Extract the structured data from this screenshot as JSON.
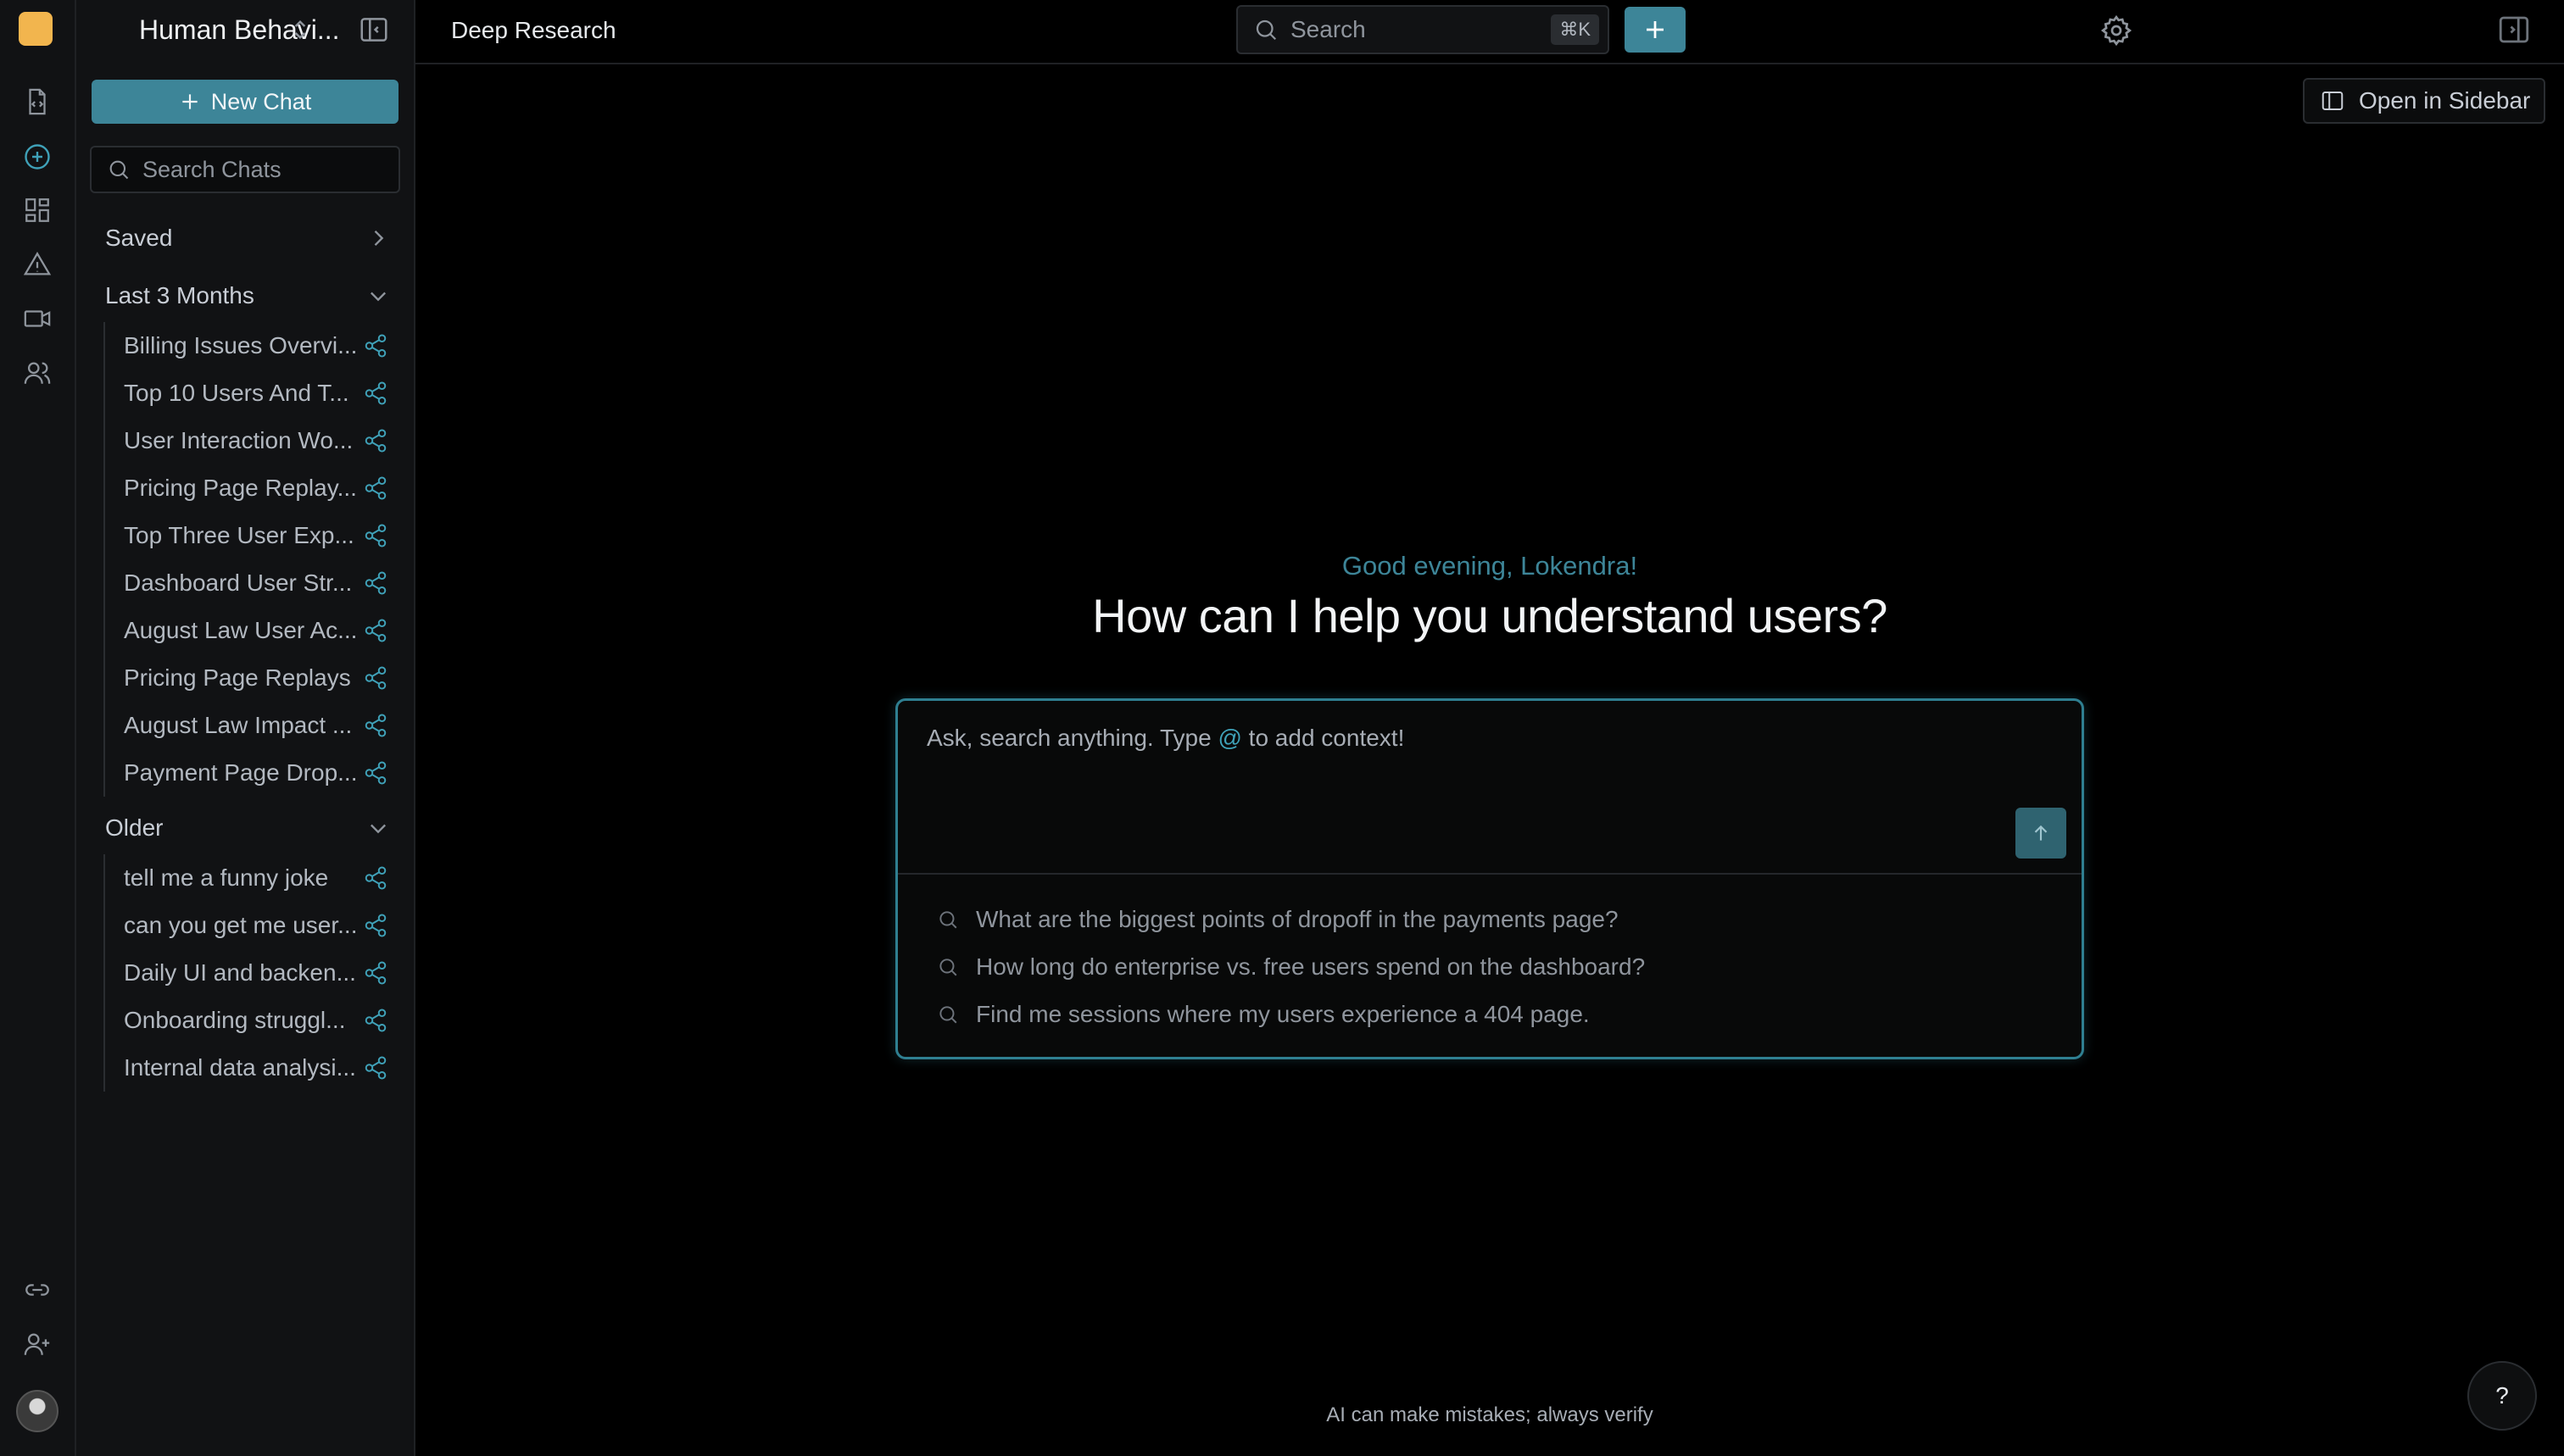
{
  "workspace": {
    "name": "Human Behavi..."
  },
  "sidebar": {
    "new_chat_label": "New Chat",
    "search_placeholder": "Search Chats",
    "sections": {
      "saved": "Saved",
      "recent": "Last 3 Months",
      "older": "Older"
    },
    "recent_chats": [
      "Billing Issues Overvi...",
      "Top 10 Users And T...",
      "User Interaction Wo...",
      "Pricing Page Replay...",
      "Top Three User Exp...",
      "Dashboard User Str...",
      "August Law User Ac...",
      "Pricing Page Replays",
      "August Law Impact ...",
      "Payment Page Drop..."
    ],
    "older_chats": [
      "tell me a funny joke",
      "can you get me user...",
      "Daily UI and backen...",
      "Onboarding struggl...",
      "Internal data analysi..."
    ]
  },
  "topbar": {
    "title": "Deep Research",
    "search_placeholder": "Search",
    "shortcut": "⌘K"
  },
  "open_sidebar_label": "Open in Sidebar",
  "main": {
    "greeting": "Good evening, Lokendra!",
    "headline": "How can I help you understand users?",
    "composer": {
      "prompt_before": "Ask, search anything. Type ",
      "prompt_at": "@",
      "prompt_after": " to add context!"
    },
    "suggestions": [
      "What are the biggest points of dropoff in the payments page?",
      "How long do enterprise vs. free users spend on the dashboard?",
      "Find me sessions where my users experience a 404 page."
    ],
    "disclaimer": "AI can make mistakes; always verify",
    "help_label": "?"
  },
  "colors": {
    "accent": "#3d8598",
    "accent_bright": "#3fa1b8",
    "brand_logo": "#f2b54e",
    "background": "#000000",
    "panel": "#111214"
  },
  "icons": {
    "rail": [
      "document-code-icon",
      "plus-circle-icon",
      "dashboard-grid-icon",
      "warning-icon",
      "video-icon",
      "users-icon",
      "link-icon",
      "add-user-icon"
    ],
    "chat_share": "share-icon"
  }
}
